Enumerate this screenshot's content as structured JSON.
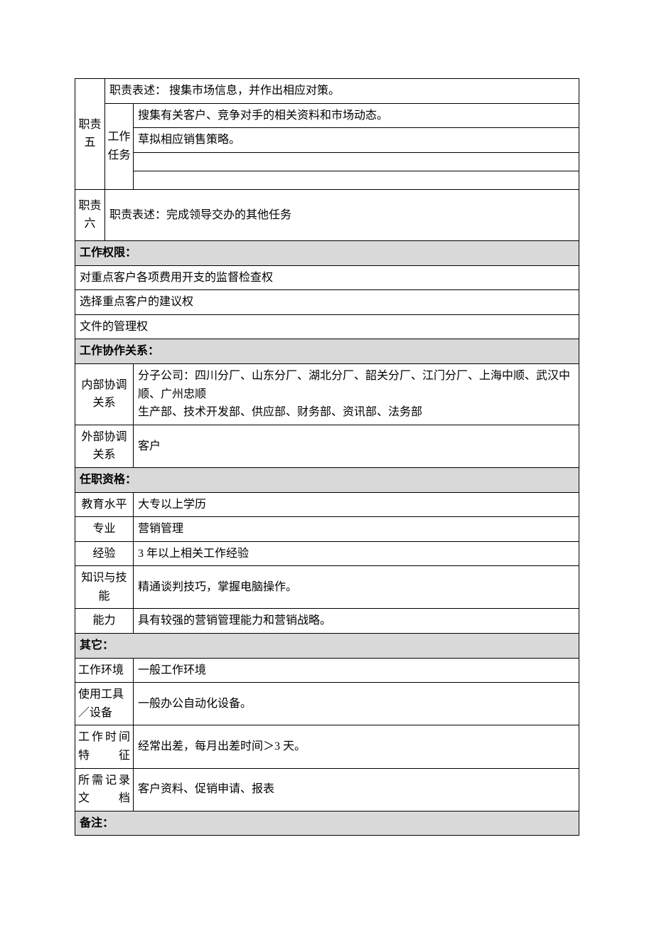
{
  "duty5": {
    "label": "职责五",
    "taskLabel": "工作任务",
    "descLabel": "职责表述：",
    "desc": " 搜集市场信息，并作出相应对策。",
    "tasks": [
      "搜集有关客户、竞争对手的相关资料和市场动态。",
      "草拟相应销售策略。",
      "",
      ""
    ]
  },
  "duty6": {
    "label": "职责六",
    "desc": "职责表述：完成领导交办的其他任务"
  },
  "sections": {
    "authority": "工作权限：",
    "coord": "工作协作关系：",
    "qual": "任职资格：",
    "other": "其它：",
    "remark": "备注："
  },
  "authority": [
    "对重点客户各项费用开支的监督检查权",
    "选择重点客户的建议权",
    "文件的管理权"
  ],
  "coord": {
    "internalLabel": "内部协调关系",
    "internal": "分子公司：四川分厂、山东分厂、湖北分厂、韶关分厂、江门分厂、上海中顺、武汉中顺、广州忠顺\n生产部、技术开发部、供应部、财务部、资讯部、法务部",
    "externalLabel": "外部协调关系",
    "external": "客户"
  },
  "qual": {
    "eduLabel": "教育水平",
    "edu": "大专以上学历",
    "majorLabel": "专业",
    "major": "营销管理",
    "expLabel": "经验",
    "exp": "3 年以上相关工作经验",
    "skillLabel": "知识与技能",
    "skill": "精通谈判技巧，掌握电脑操作。",
    "abilityLabel": "能力",
    "ability": "具有较强的营销管理能力和营销战略。"
  },
  "other": {
    "envLabel": "工作环境",
    "env": "一般工作环境",
    "toolLabel": "使用工具／设备",
    "tool": "一般办公自动化设备。",
    "timeLabel": "工作时间特征",
    "time": "经常出差，每月出差时间＞3 天。",
    "docLabel": "所需记录文档",
    "doc": "客户资料、促销申请、报表"
  }
}
